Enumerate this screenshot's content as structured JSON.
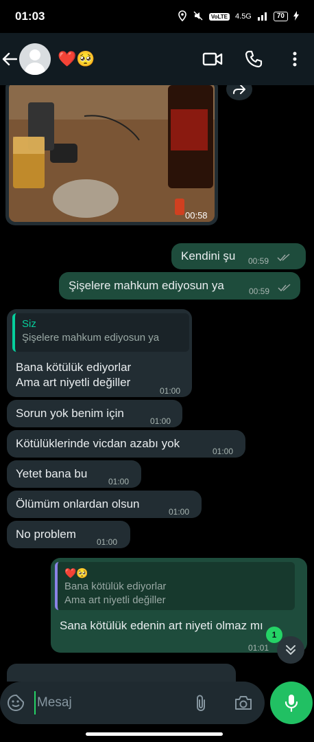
{
  "status_bar": {
    "time": "01:03",
    "network_badge": "VoLTE",
    "network_type": "4.5G",
    "battery": "70"
  },
  "header": {
    "contact_name": "❤️🥺",
    "back_icon": "arrow-left-icon",
    "video_icon": "video-camera-icon",
    "call_icon": "phone-icon",
    "menu_icon": "more-vertical-icon"
  },
  "media_message": {
    "duration": "00:58"
  },
  "outgoing_1": {
    "text": "Kendini şu",
    "time": "00:59"
  },
  "outgoing_2": {
    "text": "Şişelere mahkum ediyosun ya",
    "time": "00:59"
  },
  "reply_in": {
    "quote_author": "Siz",
    "quote_text": "Şişelere mahkum ediyosun ya",
    "text_line1": "Bana kötülük ediyorlar",
    "text_line2": "Ama art niyetli değiller",
    "time": "01:00"
  },
  "incoming": [
    {
      "text": "Sorun yok benim için",
      "time": "01:00"
    },
    {
      "text": "Kötülüklerinde vicdan azabı yok",
      "time": "01:00"
    },
    {
      "text": "Yetet bana bu",
      "time": "01:00"
    },
    {
      "text": "Ölümüm onlardan olsun",
      "time": "01:00"
    },
    {
      "text": "No problem",
      "time": "01:00"
    }
  ],
  "reply_out": {
    "quote_author": "❤️🥺",
    "quote_text_line1": "Bana kötülük ediyorlar",
    "quote_text_line2": "Ama art niyetli değiller",
    "text": "Sana kötülük edenin art niyeti olmaz mı",
    "time": "01:01"
  },
  "unread_count": "1",
  "composer": {
    "placeholder": "Mesaj"
  },
  "colors": {
    "incoming_bubble": "#222d33",
    "outgoing_bubble": "#1e4c3c",
    "accent": "#25d366",
    "header_bg": "#111b21"
  }
}
